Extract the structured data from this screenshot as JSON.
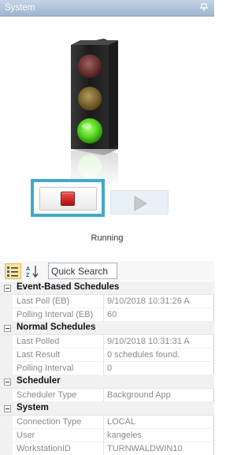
{
  "panel": {
    "title": "System",
    "pin_icon": "pin-icon"
  },
  "status": {
    "text": "Running",
    "focus_color": "#41a9c9",
    "light_active": "green"
  },
  "toolbar": {
    "categorized_icon": "categorized-view-icon",
    "sort_icon": "alphabetical-sort-icon",
    "search_value": "Quick Search"
  },
  "grid": {
    "categories": [
      {
        "label": "Event-Based Schedules",
        "rows": [
          {
            "name": "Last Poll (EB)",
            "value": "9/10/2018 10:31:26 A"
          },
          {
            "name": "Polling Interval (EB)",
            "value": "60"
          }
        ]
      },
      {
        "label": "Normal Schedules",
        "rows": [
          {
            "name": "Last Polled",
            "value": "9/10/2018 10:31:31 A"
          },
          {
            "name": "Last Result",
            "value": " 0 schedules found."
          },
          {
            "name": "Polling Interval",
            "value": "0"
          }
        ]
      },
      {
        "label": "Scheduler",
        "rows": [
          {
            "name": "Scheduler Type",
            "value": "Background App"
          }
        ]
      },
      {
        "label": "System",
        "rows": [
          {
            "name": "Connection Type",
            "value": "LOCAL"
          },
          {
            "name": "User",
            "value": "kangeles"
          },
          {
            "name": "WorkstationID",
            "value": "TURNWALDWIN10"
          }
        ]
      }
    ]
  }
}
